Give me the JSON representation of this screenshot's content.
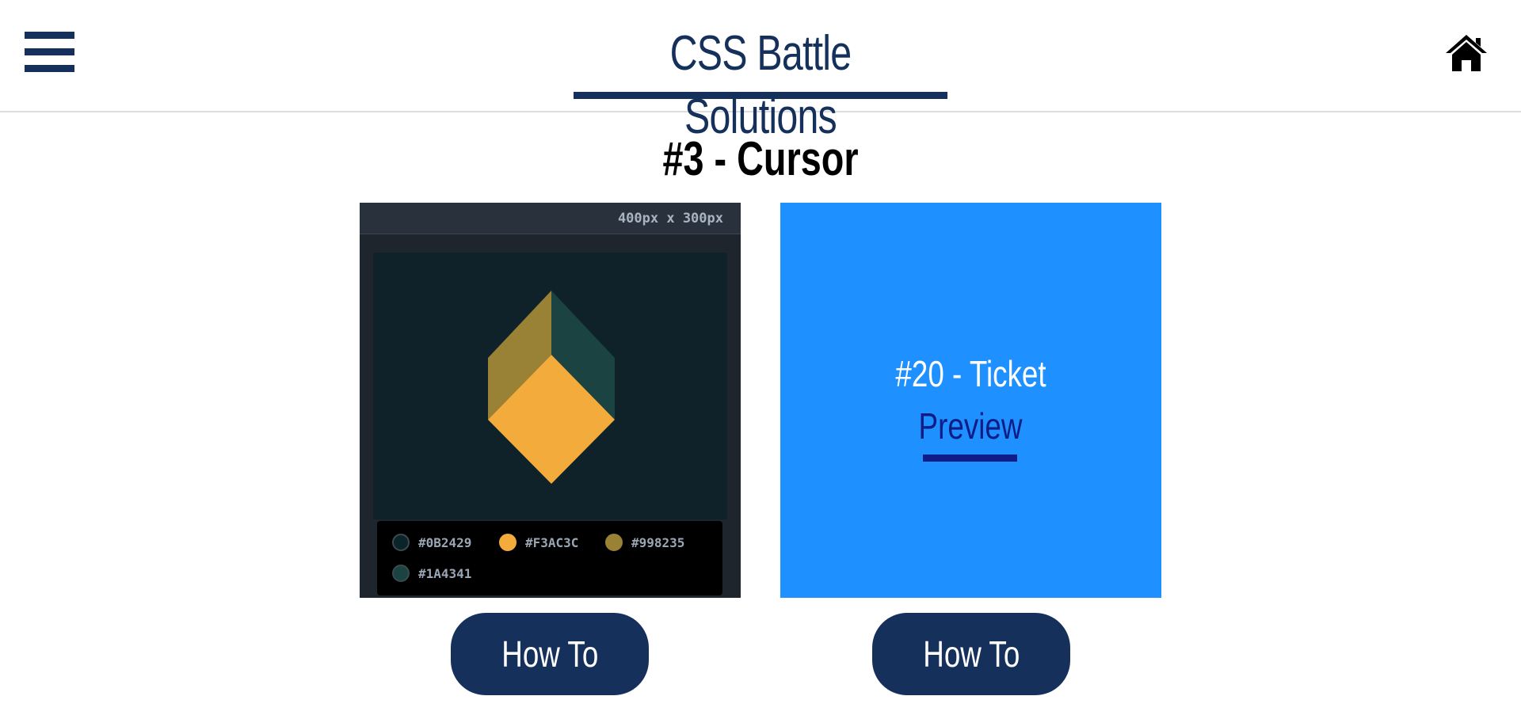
{
  "header": {
    "title": "CSS Battle Solutions",
    "menu_icon": "hamburger-menu-icon",
    "home_icon": "home-icon"
  },
  "page": {
    "heading": "#3 - Cursor"
  },
  "target_card": {
    "size_label": "400px x 300px",
    "palette": [
      {
        "hex": "#0B2429",
        "label": "#0B2429"
      },
      {
        "hex": "#F3AC3C",
        "label": "#F3AC3C"
      },
      {
        "hex": "#998235",
        "label": "#998235"
      },
      {
        "hex": "#1A4341",
        "label": "#1A4341"
      }
    ],
    "how_to_label": "How To"
  },
  "next_card": {
    "title": "#20 - Ticket",
    "preview_label": "Preview",
    "how_to_label": "How To",
    "background_color": "#1E90FF"
  },
  "colors": {
    "brand_navy": "#14305B",
    "preview_link": "#101D86"
  }
}
